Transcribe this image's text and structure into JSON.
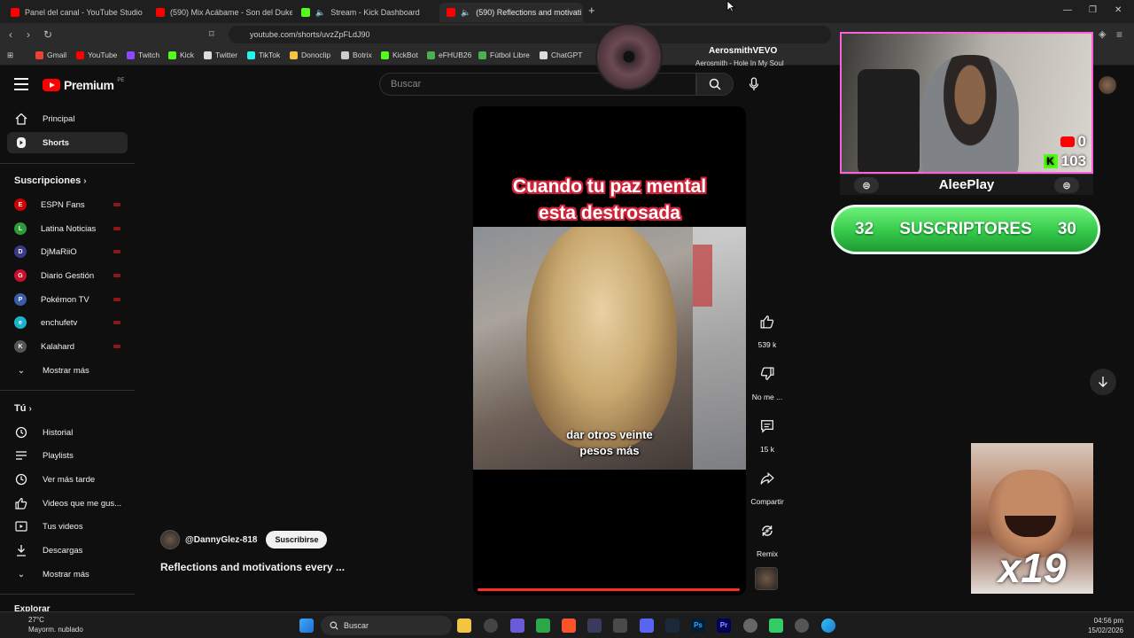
{
  "tabs": [
    {
      "title": "Panel del canal - YouTube Studio",
      "color": "#ff0000"
    },
    {
      "title": "(590) Mix Acábame - Son del Duke -",
      "color": "#ff0000"
    },
    {
      "title": "Stream - Kick Dashboard",
      "color": "#53fc18"
    },
    {
      "title": "(590) Reflections and motivati",
      "color": "#ff0000"
    }
  ],
  "address": {
    "url": "youtube.com/shorts/uvzZpFLdJ90"
  },
  "bookmarks": [
    {
      "label": "Gmail",
      "color": "#ea4335"
    },
    {
      "label": "YouTube",
      "color": "#ff0000"
    },
    {
      "label": "Twitch",
      "color": "#9146ff"
    },
    {
      "label": "Kick",
      "color": "#53fc18"
    },
    {
      "label": "Twitter",
      "color": "#dddddd"
    },
    {
      "label": "TikTok",
      "color": "#25f4ee"
    },
    {
      "label": "Donoclip",
      "color": "#f5c542"
    },
    {
      "label": "Botrix",
      "color": "#cccccc"
    },
    {
      "label": "KickBot",
      "color": "#53fc18"
    },
    {
      "label": "eFHUB26",
      "color": "#4caf50"
    },
    {
      "label": "Fútbol Libre",
      "color": "#4caf50"
    },
    {
      "label": "ChatGPT",
      "color": "#dddddd"
    }
  ],
  "header": {
    "logo_text": "Premium",
    "region": "PE",
    "search_placeholder": "Buscar"
  },
  "sidebar": {
    "main": [
      {
        "label": "Principal",
        "icon": "home-icon"
      },
      {
        "label": "Shorts",
        "icon": "shorts-icon",
        "active": true
      }
    ],
    "subscriptions_title": "Suscripciones",
    "subscriptions": [
      {
        "label": "ESPN Fans",
        "color": "#d00000",
        "initial": "E"
      },
      {
        "label": "Latina Noticias",
        "color": "#2e9b3a",
        "initial": "L"
      },
      {
        "label": "DjMaRiiO",
        "color": "#3a3a8a",
        "initial": "D"
      },
      {
        "label": "Diario Gestión",
        "color": "#c8102e",
        "initial": "G"
      },
      {
        "label": "Pokémon TV",
        "color": "#3b5ca8",
        "initial": "P"
      },
      {
        "label": "enchufetv",
        "color": "#1bb3c9",
        "initial": "e"
      },
      {
        "label": "Kalahard",
        "color": "#555555",
        "initial": "K"
      }
    ],
    "show_more": "Mostrar más",
    "you_title": "Tú",
    "you_items": [
      {
        "label": "Historial",
        "icon": "history-icon"
      },
      {
        "label": "Playlists",
        "icon": "playlist-icon"
      },
      {
        "label": "Ver más tarde",
        "icon": "clock-icon"
      },
      {
        "label": "Videos que me gus...",
        "icon": "thumbs-up-icon"
      },
      {
        "label": "Tus videos",
        "icon": "video-icon"
      },
      {
        "label": "Descargas",
        "icon": "download-icon"
      }
    ],
    "show_more_2": "Mostrar más",
    "explore_title": "Explorar"
  },
  "short": {
    "caption_line1": "Cuando tu paz mental",
    "caption_line2": "esta destrosada",
    "subtitle_line1": "dar otros veinte",
    "subtitle_line2": "pesos más",
    "channel": "@DannyGlez-818",
    "subscribe": "Suscribirse",
    "title": "Reflections and motivations every ..."
  },
  "actions": [
    {
      "label": "539 k",
      "icon": "like-icon"
    },
    {
      "label": "No me ...",
      "icon": "dislike-icon"
    },
    {
      "label": "15 k",
      "icon": "comment-icon"
    },
    {
      "label": "Compartir",
      "icon": "share-icon"
    },
    {
      "label": "Remix",
      "icon": "remix-icon"
    }
  ],
  "overlay": {
    "music_artist": "AerosmithVEVO",
    "music_track": "Aerosmith - Hole In My Soul",
    "yt_count": "0",
    "kick_count": "103",
    "streamer_name": "AleePlay",
    "subs_left": "32",
    "subs_label": "SUSCRIPTORES",
    "subs_right": "30",
    "meme_multiplier": "x19"
  },
  "taskbar": {
    "temp": "27°C",
    "weather": "Mayorm. nublado",
    "search": "Buscar",
    "time": "04:56 pm",
    "date": "15/02/2026"
  }
}
